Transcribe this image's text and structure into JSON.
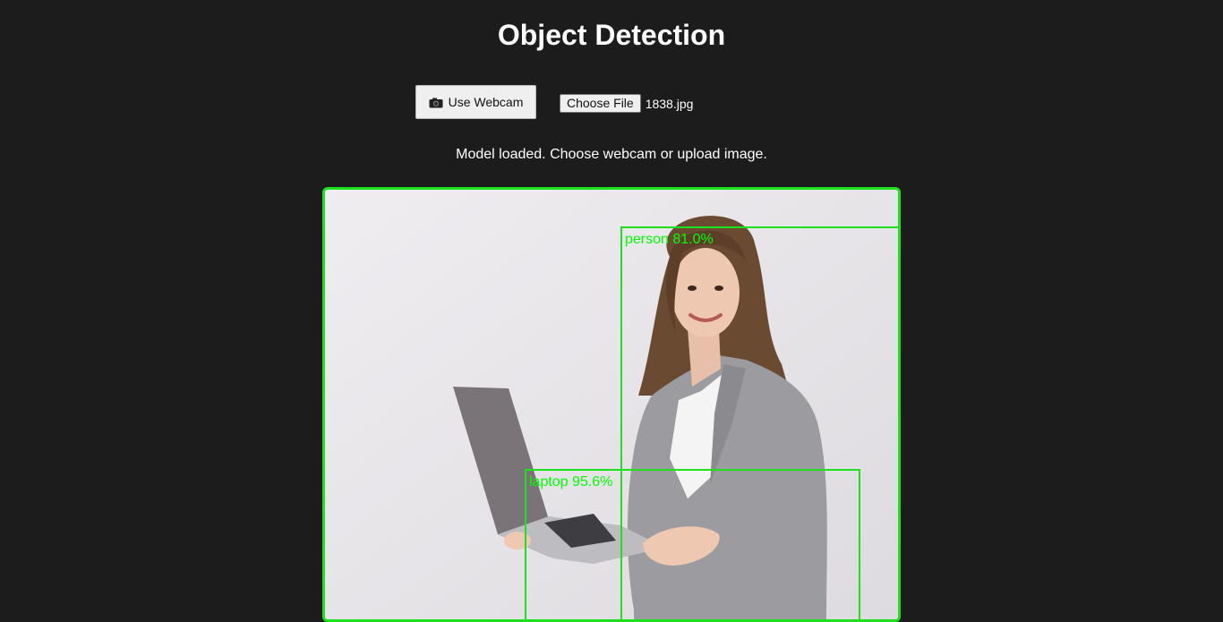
{
  "header": {
    "title": "Object Detection"
  },
  "controls": {
    "webcam_label": "Use Webcam",
    "choose_file_label": "Choose File",
    "file_name": "1838.jpg"
  },
  "status": {
    "message": "Model loaded. Choose webcam or upload image."
  },
  "detections": [
    {
      "label": "person 81.0%"
    },
    {
      "label": "laptop 95.6%"
    }
  ],
  "colors": {
    "background": "#1c1c1c",
    "accent": "#1ee11e"
  }
}
